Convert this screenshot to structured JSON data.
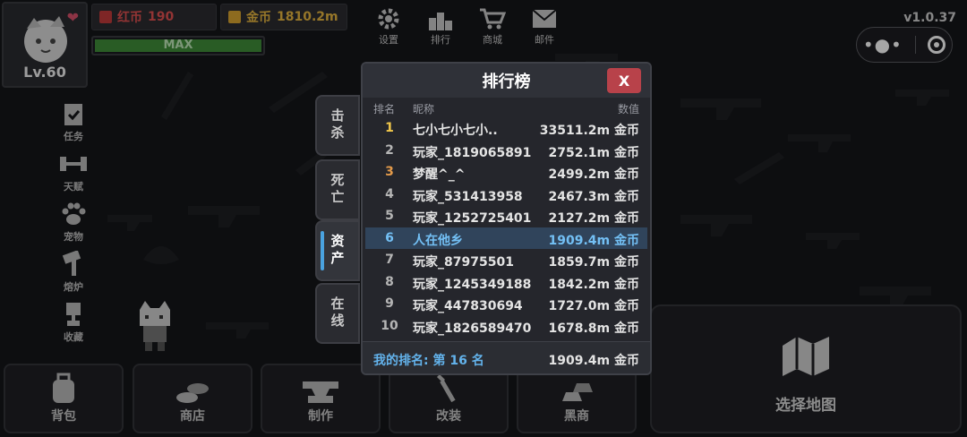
{
  "player": {
    "level": "Lv.60",
    "exp_label": "MAX",
    "exp_fraction": 1.0
  },
  "currency": {
    "red_label": "红币",
    "red_value": "190",
    "gold_label": "金币",
    "gold_value": "1810.2m"
  },
  "top_icons": [
    {
      "label": "设置",
      "icon": "gear-icon"
    },
    {
      "label": "排行",
      "icon": "podium-icon"
    },
    {
      "label": "商城",
      "icon": "cart-icon"
    },
    {
      "label": "邮件",
      "icon": "mail-icon"
    }
  ],
  "version": "v1.0.37",
  "left_menu": [
    {
      "label": "任务",
      "icon": "clipboard-check-icon"
    },
    {
      "label": "天赋",
      "icon": "dumbbell-icon"
    },
    {
      "label": "宠物",
      "icon": "paw-icon"
    },
    {
      "label": "熔炉",
      "icon": "hammer-icon"
    },
    {
      "label": "收藏",
      "icon": "trophy-icon"
    }
  ],
  "bottom_bar": [
    {
      "label": "背包",
      "icon": "backpack-icon"
    },
    {
      "label": "商店",
      "icon": "coins-icon"
    },
    {
      "label": "制作",
      "icon": "anvil-icon"
    },
    {
      "label": "改装",
      "icon": "wrench-icon"
    },
    {
      "label": "黑商",
      "icon": "gold-bars-icon"
    }
  ],
  "map_button": {
    "label": "选择地图",
    "icon": "map-icon"
  },
  "side_tabs": [
    {
      "label": "击杀",
      "active": false
    },
    {
      "label": "死亡",
      "active": false
    },
    {
      "label": "资产",
      "active": true
    },
    {
      "label": "在线",
      "active": false
    }
  ],
  "leaderboard": {
    "title": "排行榜",
    "close_label": "X",
    "col_rank": "排名",
    "col_name": "昵称",
    "col_value": "数值",
    "rows": [
      {
        "rank": "1",
        "name": "七小七小七小..",
        "value": "33511.2m 金币"
      },
      {
        "rank": "2",
        "name": "玩家_1819065891",
        "value": "2752.1m 金币"
      },
      {
        "rank": "3",
        "name": "梦醒^_^",
        "value": "2499.2m 金币"
      },
      {
        "rank": "4",
        "name": "玩家_531413958",
        "value": "2467.3m 金币"
      },
      {
        "rank": "5",
        "name": "玩家_1252725401",
        "value": "2127.2m 金币"
      },
      {
        "rank": "6",
        "name": "人在他乡",
        "value": "1909.4m 金币"
      },
      {
        "rank": "7",
        "name": "玩家_87975501",
        "value": "1859.7m 金币"
      },
      {
        "rank": "8",
        "name": "玩家_1245349188",
        "value": "1842.2m 金币"
      },
      {
        "rank": "9",
        "name": "玩家_447830694",
        "value": "1727.0m 金币"
      },
      {
        "rank": "10",
        "name": "玩家_1826589470",
        "value": "1678.8m 金币"
      }
    ],
    "my_rank_label": "我的排名: 第 16 名",
    "my_value": "1909.4m 金币"
  }
}
